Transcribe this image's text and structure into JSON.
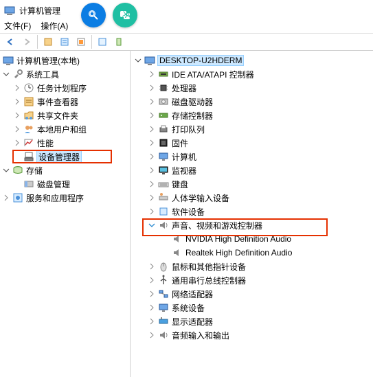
{
  "window": {
    "title": "计算机管理"
  },
  "menu": {
    "file": "文件(F)",
    "action": "操作(A)"
  },
  "left_tree": {
    "root": "计算机管理(本地)",
    "system_tools": "系统工具",
    "task_scheduler": "任务计划程序",
    "event_viewer": "事件查看器",
    "shared_folders": "共享文件夹",
    "local_users": "本地用户和组",
    "performance": "性能",
    "device_manager": "设备管理器",
    "storage": "存储",
    "disk_management": "磁盘管理",
    "services_apps": "服务和应用程序"
  },
  "right_tree": {
    "computer": "DESKTOP-U2HDERM",
    "ide": "IDE ATA/ATAPI 控制器",
    "cpu": "处理器",
    "disk_drive": "磁盘驱动器",
    "storage_ctrl": "存储控制器",
    "print_queue": "打印队列",
    "firmware": "固件",
    "computer_node": "计算机",
    "monitor": "监视器",
    "keyboard": "键盘",
    "hid": "人体学输入设备",
    "software_device": "软件设备",
    "sound": "声音、视频和游戏控制器",
    "sound_child_1": "NVIDIA High Definition Audio",
    "sound_child_2": "Realtek High Definition Audio",
    "mouse": "鼠标和其他指针设备",
    "usb": "通用串行总线控制器",
    "network": "网络适配器",
    "system_dev": "系统设备",
    "display": "显示适配器",
    "audio_io": "音频输入和输出"
  }
}
